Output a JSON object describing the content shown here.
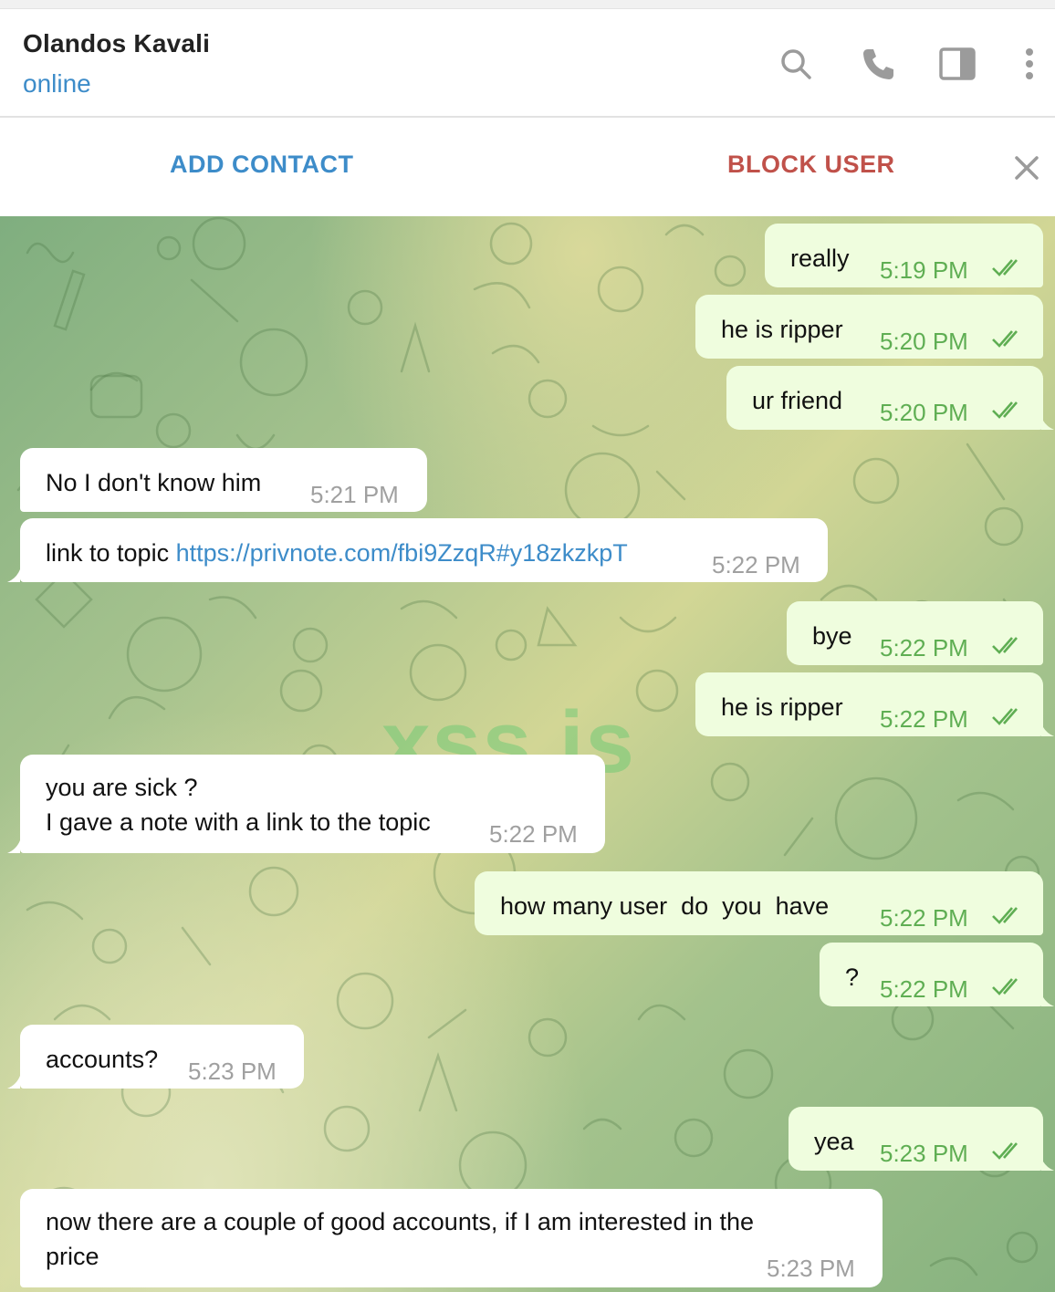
{
  "header": {
    "contact_name": "Olandos Kavali",
    "status": "online",
    "icons": [
      "search-icon",
      "phone-icon",
      "sidebar-toggle-icon",
      "more-vertical-icon"
    ]
  },
  "action_bar": {
    "add_contact_label": "ADD CONTACT",
    "block_user_label": "BLOCK USER",
    "close_icon": "close-icon"
  },
  "watermark": "xss.is",
  "colors": {
    "accent": "#3d8cc9",
    "danger": "#c0514a",
    "outgoing_bubble": "#effdde",
    "outgoing_time": "#5fae53",
    "incoming_bubble": "#ffffff"
  },
  "messages": [
    {
      "direction": "out",
      "text": "really",
      "time": "5:19 PM",
      "read": true
    },
    {
      "direction": "out",
      "text": "he is ripper",
      "time": "5:20 PM",
      "read": true
    },
    {
      "direction": "out",
      "text": "ur friend",
      "time": "5:20 PM",
      "read": true
    },
    {
      "direction": "in",
      "text": "No I don't know him",
      "time": "5:21 PM"
    },
    {
      "direction": "in",
      "text_prefix": "link to topic ",
      "link": "https://privnote.com/fbi9ZzqR#y18zkzkpT",
      "time": "5:22 PM"
    },
    {
      "direction": "out",
      "text": "bye",
      "time": "5:22 PM",
      "read": true
    },
    {
      "direction": "out",
      "text": "he is ripper",
      "time": "5:22 PM",
      "read": true
    },
    {
      "direction": "in",
      "line1": "you are sick ?",
      "line2": "I gave a note with a link to the topic",
      "time": "5:22 PM"
    },
    {
      "direction": "out",
      "text": "how many user  do  you  have",
      "time": "5:22 PM",
      "read": true
    },
    {
      "direction": "out",
      "text": "?",
      "time": "5:22 PM",
      "read": true
    },
    {
      "direction": "in",
      "text": "accounts?",
      "time": "5:23 PM"
    },
    {
      "direction": "out",
      "text": "yea",
      "time": "5:23 PM",
      "read": true
    },
    {
      "direction": "in",
      "line1": "now there are a couple of good accounts, if I am interested in the",
      "line2": "price",
      "time": "5:23 PM"
    }
  ]
}
